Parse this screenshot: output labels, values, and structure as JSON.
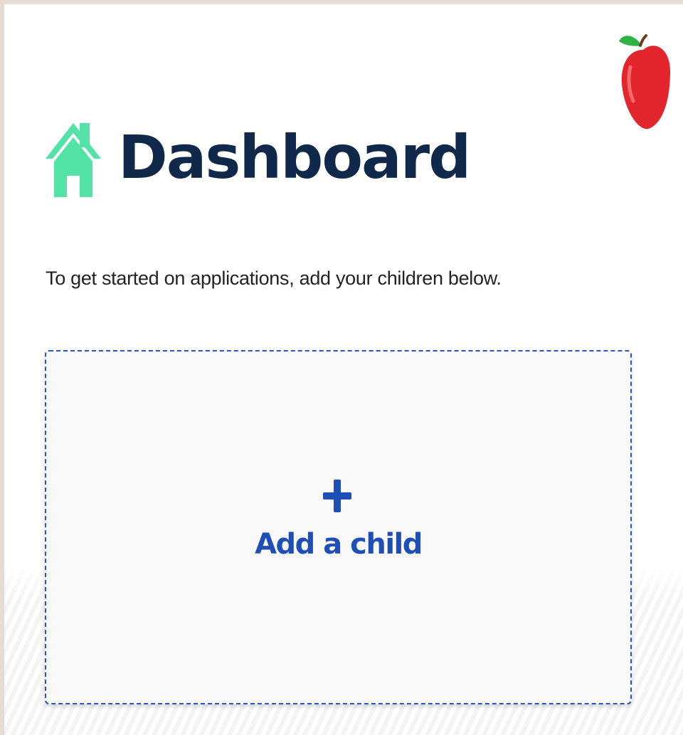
{
  "header": {
    "title": "Dashboard",
    "home_icon": "home-icon",
    "logo_icon": "apple-icon"
  },
  "main": {
    "intro_text": "To get started on applications, add your children below.",
    "add_child": {
      "label": "Add a child",
      "icon": "plus-icon"
    }
  },
  "colors": {
    "title": "#10284a",
    "home_icon": "#53e3a6",
    "accent": "#1f4fb6",
    "apple_red": "#e3262d",
    "apple_leaf": "#2fb344"
  }
}
